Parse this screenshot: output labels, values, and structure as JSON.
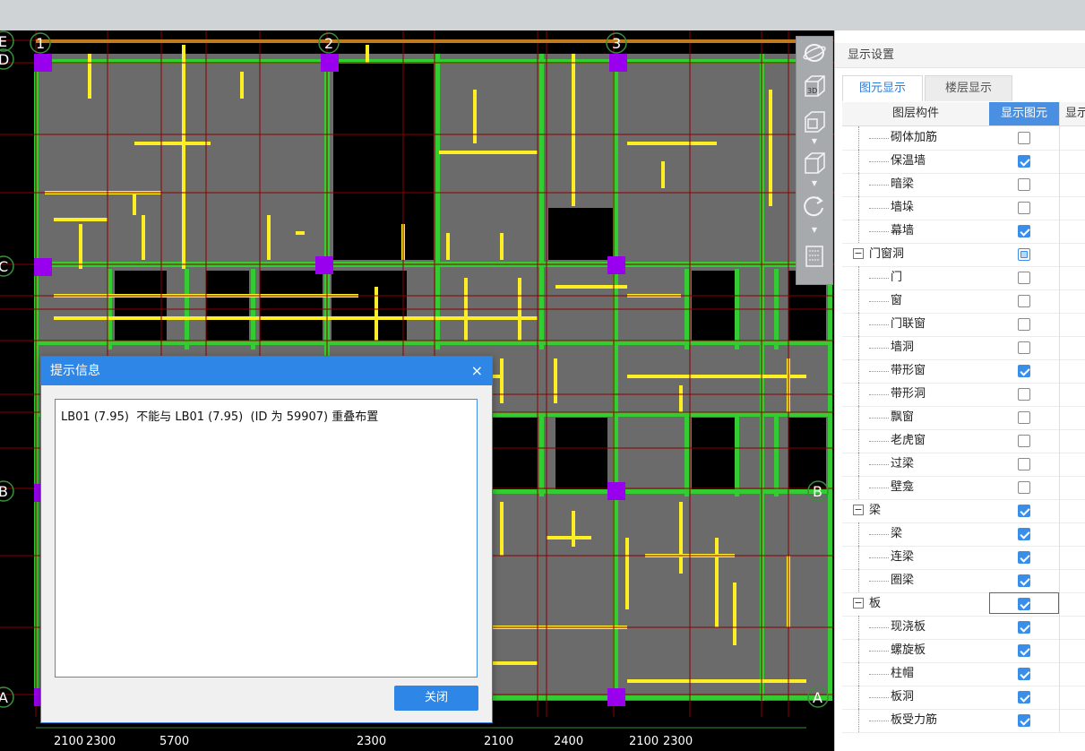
{
  "cad": {
    "axis_top": [
      "1",
      "2",
      "3"
    ],
    "axis_left": [
      "E",
      "D",
      "C",
      "B",
      "A"
    ],
    "axis_right": [
      "B",
      "A"
    ],
    "bottom_dims": [
      "2100",
      "2300",
      "5700",
      "2300",
      "2100",
      "2400",
      "2100",
      "2300"
    ]
  },
  "toolbar": {
    "icons": [
      "orbit-icon",
      "view-3d-icon",
      "view-front-icon",
      "view-iso-icon",
      "rotate-icon",
      "layers-icon"
    ],
    "label_3d": "3D"
  },
  "panel": {
    "title": "显示设置",
    "tabs": [
      {
        "label": "图元显示",
        "active": true
      },
      {
        "label": "楼层显示",
        "active": false
      }
    ],
    "columns": {
      "component": "图层构件",
      "show_element": "显示图元",
      "show_name": "显示"
    },
    "rows": [
      {
        "label": "砌体加筋",
        "level": 1,
        "checked": false
      },
      {
        "label": "保温墙",
        "level": 1,
        "checked": true
      },
      {
        "label": "暗梁",
        "level": 1,
        "checked": false
      },
      {
        "label": "墙垛",
        "level": 1,
        "checked": false
      },
      {
        "label": "幕墙",
        "level": 1,
        "checked": true
      },
      {
        "label": "门窗洞",
        "level": 0,
        "checked": "partial",
        "expander": "−"
      },
      {
        "label": "门",
        "level": 1,
        "checked": false
      },
      {
        "label": "窗",
        "level": 1,
        "checked": false
      },
      {
        "label": "门联窗",
        "level": 1,
        "checked": false
      },
      {
        "label": "墙洞",
        "level": 1,
        "checked": false
      },
      {
        "label": "带形窗",
        "level": 1,
        "checked": true
      },
      {
        "label": "带形洞",
        "level": 1,
        "checked": false
      },
      {
        "label": "飘窗",
        "level": 1,
        "checked": false
      },
      {
        "label": "老虎窗",
        "level": 1,
        "checked": false
      },
      {
        "label": "过梁",
        "level": 1,
        "checked": false
      },
      {
        "label": "壁龛",
        "level": 1,
        "checked": false
      },
      {
        "label": "梁",
        "level": 0,
        "checked": true,
        "expander": "−"
      },
      {
        "label": "梁",
        "level": 1,
        "checked": true
      },
      {
        "label": "连梁",
        "level": 1,
        "checked": true
      },
      {
        "label": "圈梁",
        "level": 1,
        "checked": true
      },
      {
        "label": "板",
        "level": 0,
        "checked": true,
        "expander": "−",
        "focused": true
      },
      {
        "label": "现浇板",
        "level": 1,
        "checked": true
      },
      {
        "label": "螺旋板",
        "level": 1,
        "checked": true
      },
      {
        "label": "柱帽",
        "level": 1,
        "checked": true
      },
      {
        "label": "板洞",
        "level": 1,
        "checked": true
      },
      {
        "label": "板受力筋",
        "level": 1,
        "checked": true
      }
    ]
  },
  "dialog": {
    "title": "提示信息",
    "close_icon": "×",
    "message": "LB01 (7.95)  不能与 LB01 (7.95)  (ID 为 59907) 重叠布置",
    "close_button": "关闭"
  },
  "colors": {
    "accent": "#2e87e6",
    "beam": "#33cc33",
    "rebar": "#ffee22",
    "column": "#9900ee",
    "slab": "#6b6b6b",
    "axis": "#8b0000"
  }
}
